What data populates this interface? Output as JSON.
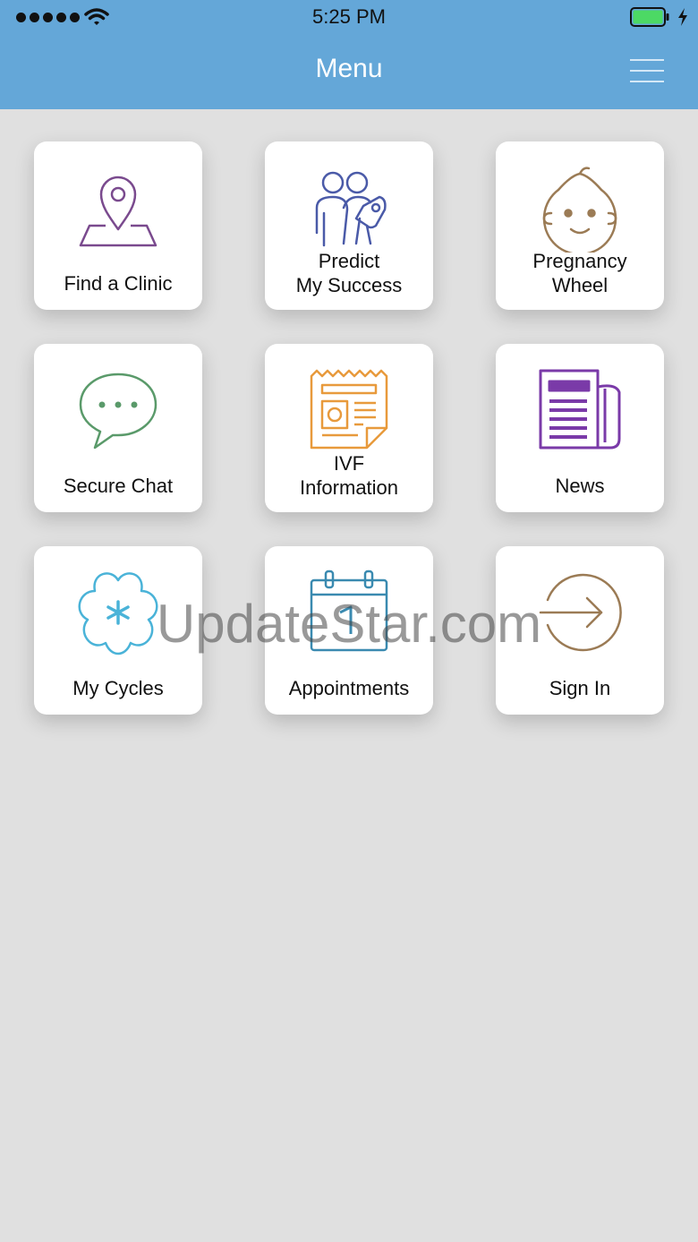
{
  "status_bar": {
    "time": "5:25 PM",
    "signal_icon": "signal-dots-icon",
    "wifi_icon": "wifi-icon",
    "battery_icon": "battery-charging-icon",
    "battery_color": "#4cd964"
  },
  "header": {
    "title": "Menu",
    "menu_icon": "hamburger-icon",
    "background_color": "#64a7d8"
  },
  "tiles": [
    {
      "label": "Find a Clinic",
      "icon": "map-pin-icon",
      "color": "#7a4a8e"
    },
    {
      "label": "Predict\nMy Success",
      "icon": "people-tag-icon",
      "color": "#4a5aa8"
    },
    {
      "label": "Pregnancy\nWheel",
      "icon": "baby-face-icon",
      "color": "#9b7b55"
    },
    {
      "label": "Secure Chat",
      "icon": "chat-bubble-icon",
      "color": "#5a9a6a"
    },
    {
      "label": "IVF\nInformation",
      "icon": "document-icon",
      "color": "#e89a3c"
    },
    {
      "label": "News",
      "icon": "newspaper-icon",
      "color": "#7a3aa8"
    },
    {
      "label": "My Cycles",
      "icon": "flower-icon",
      "color": "#4ab3d8"
    },
    {
      "label": "Appointments",
      "icon": "calendar-icon",
      "color": "#3a8ab0"
    },
    {
      "label": "Sign In",
      "icon": "sign-in-arrow-icon",
      "color": "#9b7b55"
    }
  ],
  "watermark": "UpdateStar.com"
}
